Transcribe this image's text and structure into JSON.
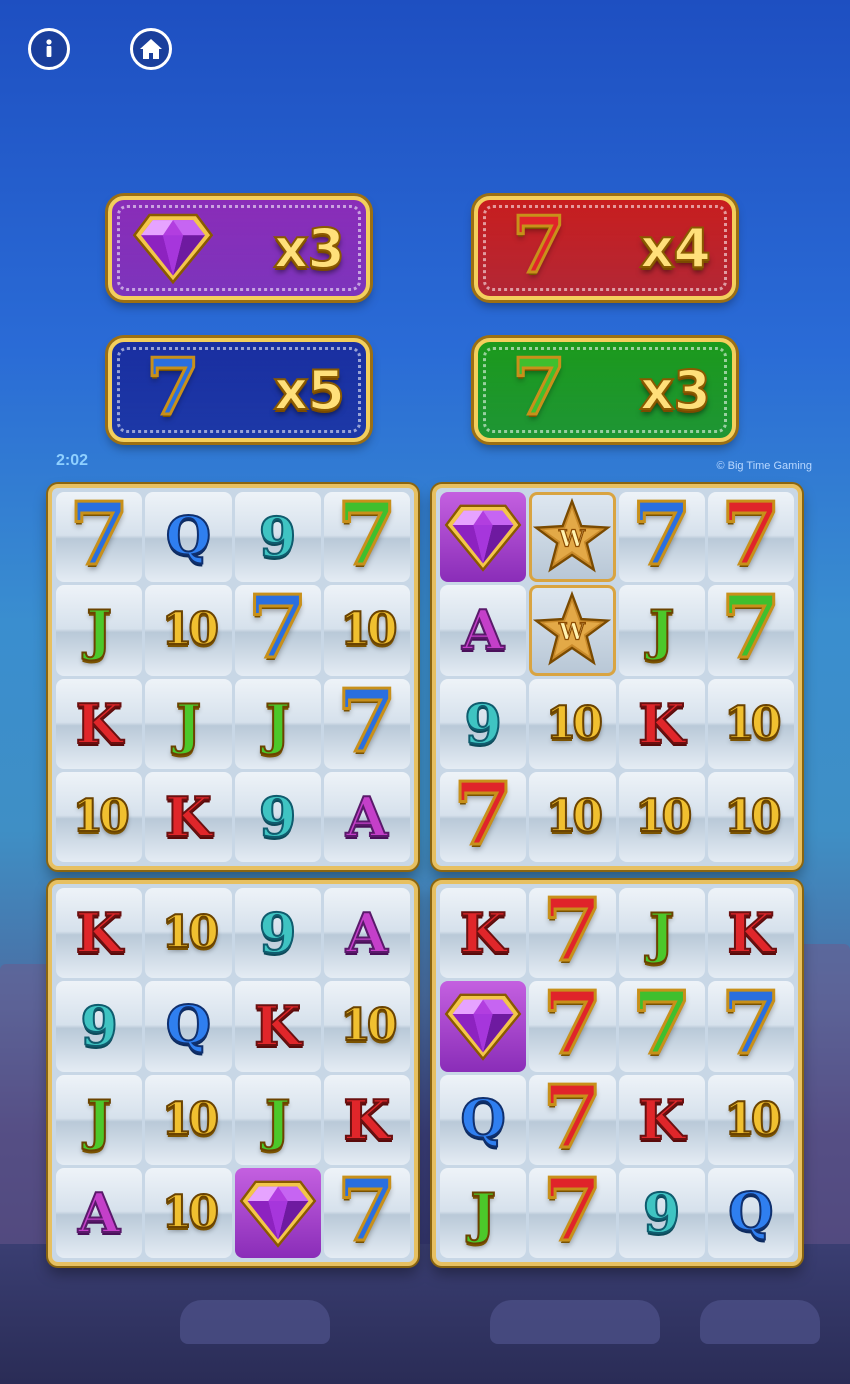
{
  "hud": {
    "info_icon": "info-icon",
    "home_icon": "home-icon",
    "timer": "2:02",
    "copyright": "© Big Time Gaming"
  },
  "multipliers": [
    {
      "symbol": "gem",
      "label": "x3",
      "color": "#8a2db8"
    },
    {
      "symbol": "7",
      "label": "x4",
      "color": "#c81e1e"
    },
    {
      "symbol": "7",
      "label": "x5",
      "color": "#1a2fa0"
    },
    {
      "symbol": "7",
      "label": "x3",
      "color": "#1c9a1c"
    }
  ],
  "grids": [
    {
      "name": "top-left",
      "rows": [
        [
          {
            "s": "7",
            "c": "blue"
          },
          {
            "s": "Q"
          },
          {
            "s": "9"
          },
          {
            "s": "7",
            "c": "green"
          }
        ],
        [
          {
            "s": "J"
          },
          {
            "s": "10"
          },
          {
            "s": "7",
            "c": "blue"
          },
          {
            "s": "10"
          }
        ],
        [
          {
            "s": "K"
          },
          {
            "s": "J"
          },
          {
            "s": "J"
          },
          {
            "s": "7",
            "c": "blue"
          }
        ],
        [
          {
            "s": "10"
          },
          {
            "s": "K"
          },
          {
            "s": "9"
          },
          {
            "s": "A"
          }
        ]
      ]
    },
    {
      "name": "top-right",
      "rows": [
        [
          {
            "s": "gem"
          },
          {
            "s": "W"
          },
          {
            "s": "7",
            "c": "blue"
          },
          {
            "s": "7",
            "c": "red"
          }
        ],
        [
          {
            "s": "A"
          },
          {
            "s": "W"
          },
          {
            "s": "J"
          },
          {
            "s": "7",
            "c": "green"
          }
        ],
        [
          {
            "s": "9"
          },
          {
            "s": "10"
          },
          {
            "s": "K"
          },
          {
            "s": "10"
          }
        ],
        [
          {
            "s": "7",
            "c": "red"
          },
          {
            "s": "10"
          },
          {
            "s": "10"
          },
          {
            "s": "10"
          }
        ]
      ]
    },
    {
      "name": "bottom-left",
      "rows": [
        [
          {
            "s": "K"
          },
          {
            "s": "10"
          },
          {
            "s": "9"
          },
          {
            "s": "A"
          }
        ],
        [
          {
            "s": "9"
          },
          {
            "s": "Q"
          },
          {
            "s": "K"
          },
          {
            "s": "10"
          }
        ],
        [
          {
            "s": "J"
          },
          {
            "s": "10"
          },
          {
            "s": "J"
          },
          {
            "s": "K"
          }
        ],
        [
          {
            "s": "A"
          },
          {
            "s": "10"
          },
          {
            "s": "gem"
          },
          {
            "s": "7",
            "c": "blue"
          }
        ]
      ]
    },
    {
      "name": "bottom-right",
      "rows": [
        [
          {
            "s": "K"
          },
          {
            "s": "7",
            "c": "red"
          },
          {
            "s": "J"
          },
          {
            "s": "K"
          }
        ],
        [
          {
            "s": "gem"
          },
          {
            "s": "7",
            "c": "red"
          },
          {
            "s": "7",
            "c": "green"
          },
          {
            "s": "7",
            "c": "blue"
          }
        ],
        [
          {
            "s": "Q"
          },
          {
            "s": "7",
            "c": "red"
          },
          {
            "s": "K"
          },
          {
            "s": "10"
          }
        ],
        [
          {
            "s": "J"
          },
          {
            "s": "7",
            "c": "red"
          },
          {
            "s": "9"
          },
          {
            "s": "Q"
          }
        ]
      ]
    }
  ]
}
